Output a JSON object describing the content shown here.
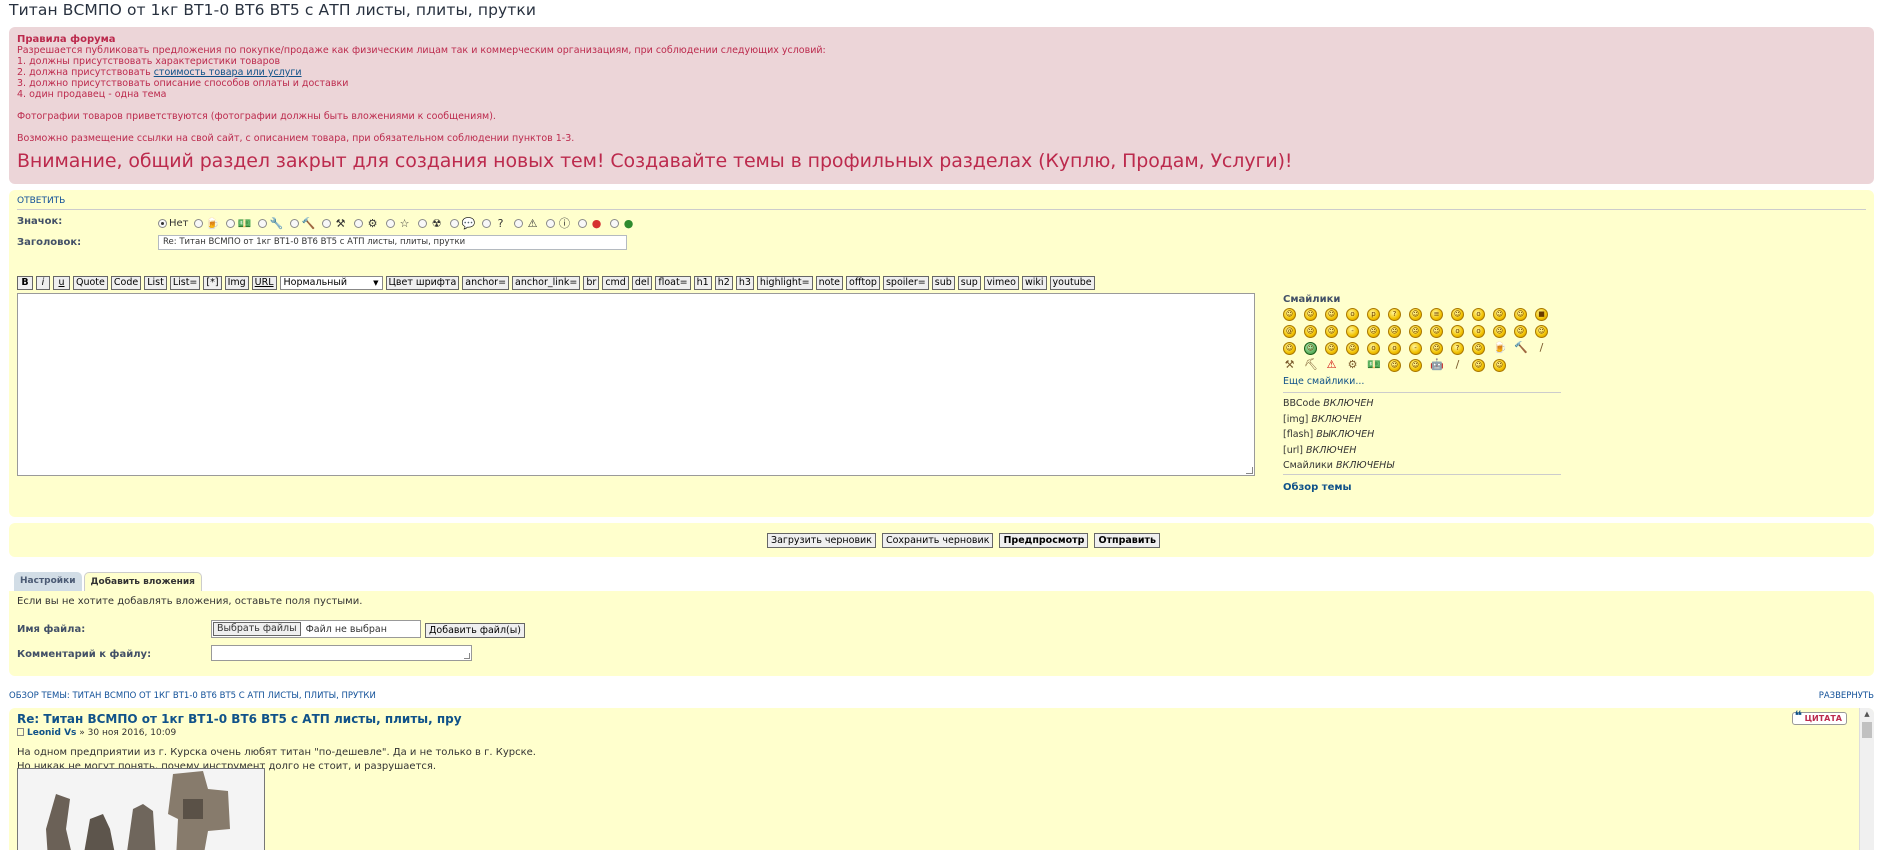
{
  "topic_title": "Титан ВСМПО от 1кг ВТ1-0 ВТ6 ВТ5 с АТП листы, плиты, прутки",
  "rules": {
    "title": "Правила форума",
    "intro": "Разрешается публиковать предложения по покупке/продаже как физическим лицам так и коммерческим организациям, при соблюдении следующих условий:",
    "item1": "1. должны присутствовать характеристики товаров",
    "item2_prefix": "2. должна присутствовать ",
    "item2_link": "стоимость товара или услуги",
    "item3": "3. должно присутствовать описание способов оплаты и доставки",
    "item4": "4. один продавец - одна тема",
    "photos": "Фотографии товаров приветствуются (фотографии должны быть вложениями к сообщениям).",
    "links": "Возможно размещение ссылки на свой сайт, с описанием товара, при обязательном соблюдении пунктов 1-3.",
    "warning": "Внимание, общий раздел закрыт для создания новых тем! Создавайте темы в профильных разделах (Куплю, Продам, Услуги)!"
  },
  "reply": {
    "section_title": "ОТВЕТИТЬ",
    "icon_label": "Значок:",
    "icon_none": "Нет",
    "subject_label": "Заголовок:",
    "subject_value": "Re: Титан ВСМПО от 1кг ВТ1-0 ВТ6 ВТ5 с АТП листы, плиты, прутки"
  },
  "toolbar": {
    "bold": "B",
    "italic": "i",
    "underline": "u",
    "quote": "Quote",
    "code": "Code",
    "list": "List",
    "list_eq": "List=",
    "list_item": "[*]",
    "img": "Img",
    "url": "URL",
    "size_select": "Нормальный",
    "font_color": "Цвет шрифта",
    "anchor_eq": "anchor=",
    "anchor_link": "anchor_link=",
    "br": "br",
    "cmd": "cmd",
    "del": "del",
    "float": "float=",
    "h1": "h1",
    "h2": "h2",
    "h3": "h3",
    "highlight": "highlight=",
    "note": "note",
    "offtop": "offtop",
    "spoiler": "spoiler=",
    "sub": "sub",
    "sup": "sup",
    "vimeo": "vimeo",
    "wiki": "wiki",
    "youtube": "youtube"
  },
  "smilies": {
    "title": "Смайлики",
    "more": "Еще смайлики...",
    "bbcode": "BBCode",
    "bbcode_status": "ВКЛЮЧЕН",
    "img": "[img]",
    "img_status": "ВКЛЮЧЕН",
    "flash": "[flash]",
    "flash_status": "ВЫКЛЮЧЕН",
    "url": "[url]",
    "url_status": "ВКЛЮЧЕН",
    "smilies": "Смайлики",
    "smilies_status": "ВКЛЮЧЕНЫ",
    "topic_review": "Обзор темы"
  },
  "buttons": {
    "load_draft": "Загрузить черновик",
    "save_draft": "Сохранить черновик",
    "preview": "Предпросмотр",
    "submit": "Отправить"
  },
  "tabs": {
    "settings": "Настройки",
    "attachments": "Добавить вложения"
  },
  "attach": {
    "note": "Если вы не хотите добавлять вложения, оставьте поля пустыми.",
    "filename_label": "Имя файла:",
    "choose_file": "Выбрать файлы",
    "no_file": "Файл не выбран",
    "add_file": "Добавить файл(ы)",
    "comment_label": "Комментарий к файлу:"
  },
  "review": {
    "header": "ОБЗОР ТЕМЫ: ТИТАН ВСМПО ОТ 1КГ ВТ1-0 ВТ6 ВТ5 С АТП ЛИСТЫ, ПЛИТЫ, ПРУТКИ",
    "expand": "РАЗВЕРНУТЬ",
    "post_title": "Re: Титан ВСМПО от 1кг ВТ1-0 ВТ6 ВТ5 с АТП листы, плиты, пру",
    "author": "Leonid Vs",
    "date": " » 30 ноя 2016, 10:09",
    "quote": "ЦИТАТА",
    "line1": "На одном предприятии из г. Курска очень любят титан \"по-дешевле\". Да и не только в г. Курске.",
    "line2": "Но никак не могут понять, почему инструмент долго не стоит, и разрушается."
  },
  "colors": {
    "rules_bg": "#ecd5d8",
    "rules_text": "#bc2a4d",
    "panel_bg": "#ffffcd",
    "link": "#105289",
    "title": "#28313f"
  }
}
